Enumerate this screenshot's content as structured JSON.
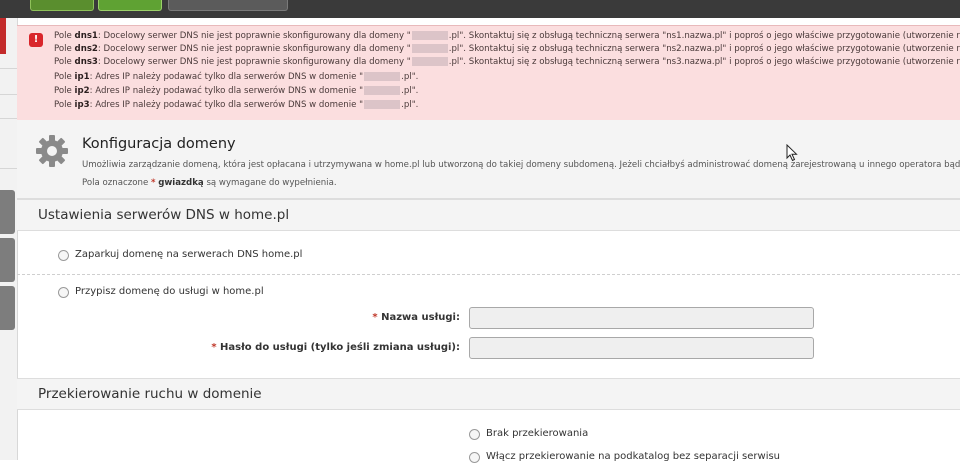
{
  "colors": {
    "error_bg": "#fbdedf",
    "accent_red": "#c0392b",
    "button_green": "#5fa233"
  },
  "errors": [
    {
      "pre": "Pole ",
      "field": "dns1",
      "a": ": Docelowy serwer DNS nie jest poprawnie skonfigurowany dla domeny \"",
      "b": ".pl\". Skontaktuj się z obsługą techniczną serwera \"ns1.nazwa.pl\" i poproś o jego właściwe przygotowanie (utworzenie rekor"
    },
    {
      "pre": "Pole ",
      "field": "dns2",
      "a": ": Docelowy serwer DNS nie jest poprawnie skonfigurowany dla domeny \"",
      "b": ".pl\". Skontaktuj się z obsługą techniczną serwera \"ns2.nazwa.pl\" i poproś o jego właściwe przygotowanie (utworzenie rekor"
    },
    {
      "pre": "Pole ",
      "field": "dns3",
      "a": ": Docelowy serwer DNS nie jest poprawnie skonfigurowany dla domeny \"",
      "b": ".pl\". Skontaktuj się z obsługą techniczną serwera \"ns3.nazwa.pl\" i poproś o jego właściwe przygotowanie (utworzenie rekor"
    },
    {
      "pre": "Pole ",
      "field": "ip1",
      "a": ": Adres IP należy podawać tylko dla serwerów DNS w domenie \"",
      "b": ".pl\"."
    },
    {
      "pre": "Pole ",
      "field": "ip2",
      "a": ": Adres IP należy podawać tylko dla serwerów DNS w domenie \"",
      "b": ".pl\"."
    },
    {
      "pre": "Pole ",
      "field": "ip3",
      "a": ": Adres IP należy podawać tylko dla serwerów DNS w domenie \"",
      "b": ".pl\"."
    }
  ],
  "config": {
    "title": "Konfiguracja domeny",
    "description": "Umożliwia zarządzanie domeną, która jest opłacana i utrzymywana w home.pl lub utworzoną do takiej domeny subdomeną. Jeżeli chciałbyś administrować domeną zarejestrowaną u innego operatora bądź też n",
    "required_pre": "Pola oznaczone ",
    "required_star": "*",
    "required_word": "gwiazdką",
    "required_post": " są wymagane do wypełnienia."
  },
  "dns_section": {
    "title": "Ustawienia serwerów DNS w home.pl",
    "option_park": "Zaparkuj domenę na serwerach DNS home.pl",
    "option_assign": "Przypisz domenę do usługi w home.pl",
    "service_name_label": "Nazwa usługi:",
    "service_password_label": "Hasło do usługi (tylko jeśli zmiana usługi):",
    "star": "*",
    "service_name_value": "",
    "service_password_value": ""
  },
  "redirect_section": {
    "title": "Przekierowanie ruchu w domenie",
    "option_none": "Brak przekierowania",
    "option_subdir": "Włącz przekierowanie na podkatalog bez separacji serwisu"
  }
}
